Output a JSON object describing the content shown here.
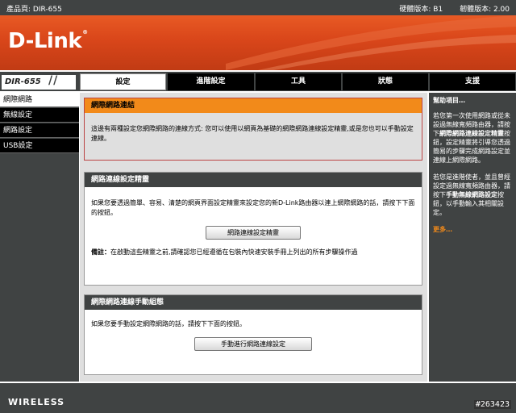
{
  "topbar": {
    "product": "產品頁: DIR-655",
    "hw_version": "硬體版本: B1",
    "fw_version": "韌體版本: 2.00"
  },
  "brand": {
    "logo": "D-Link",
    "reg": "®"
  },
  "model": {
    "label": "DIR-655",
    "slashes": "//"
  },
  "tabs": [
    {
      "label": "設定",
      "active": true
    },
    {
      "label": "進階設定"
    },
    {
      "label": "工具"
    },
    {
      "label": "狀態"
    },
    {
      "label": "支援"
    }
  ],
  "sidebar": {
    "items": [
      {
        "label": "網際網路",
        "active": true
      },
      {
        "label": "無線設定"
      },
      {
        "label": "網路設定"
      },
      {
        "label": "USB設定"
      }
    ]
  },
  "section1": {
    "title": "網際網路連結",
    "text": "這邊有兩種設定您網際網路的連線方式: 您可以使用以網頁為基礎的網際網路連線設定精靈,或是您也可以手動設定連線。"
  },
  "section2": {
    "title": "網路連線設定精靈",
    "text": "如果您要透過簡單、容易、清楚的網頁界面設定精靈來設定您的新D-Link路由器以連上網際網路的話，請按下下面的按鈕。",
    "button": "網路連線設定精靈",
    "note_label": "備註：",
    "note": "在啟動這些精靈之前,請確認您已經遵循在包裝內快速安裝手冊上列出的所有步驟操作過"
  },
  "section3": {
    "title": "網際網路連線手動組態",
    "text": "如果您要手動設定網際網路的話，請按下下面的按鈕。",
    "button": "手動進行網路連線設定"
  },
  "help": {
    "title": "幫助項目…",
    "p1_a": "若您第一次使用網路或從未設過無線寬頻路由器，請按下",
    "p1_b": "網際網路連線設定精靈",
    "p1_c": "按鈕，設定精靈將引導您透過簡易的步驟完成網路設定並連線上網際網路。",
    "p2_a": "若您是進階使者，並且曾經設定過無線寬頻路由器，請按下",
    "p2_b": "手動無線網路設定",
    "p2_c": "按鈕，以手動輸入其相關設定。",
    "more": "更多…"
  },
  "footer": {
    "brand": "WIRELESS",
    "id": "#263423"
  },
  "colors": {
    "orange": "#f28a1a",
    "banner": "#d9461a",
    "dark": "#404343"
  }
}
